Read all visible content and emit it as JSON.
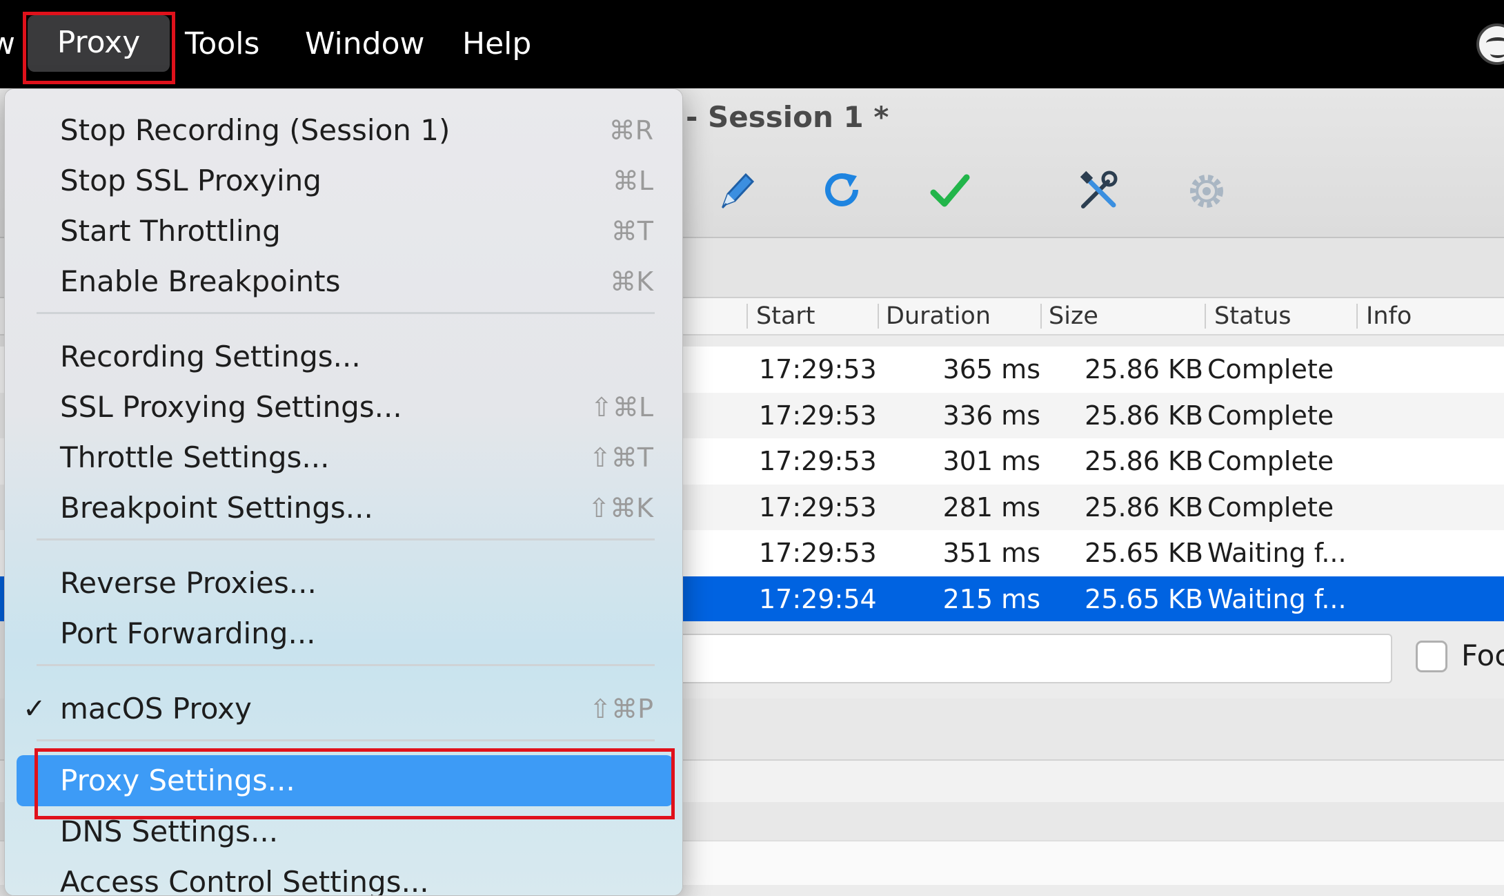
{
  "menubar": {
    "partial_item": "w",
    "items": [
      "Proxy",
      "Tools",
      "Window",
      "Help"
    ],
    "app_icon": "charles-logo-icon"
  },
  "window": {
    "title": "- Session 1 *",
    "toolbar_icons": [
      "pen-icon",
      "refresh-icon",
      "checkmark-icon",
      "tools-icon",
      "gear-icon"
    ]
  },
  "table": {
    "headers": [
      "Start",
      "Duration",
      "Size",
      "Status",
      "Info"
    ],
    "rows": [
      {
        "start": "17:29:53",
        "duration": "365 ms",
        "size": "25.86 KB",
        "status": "Complete"
      },
      {
        "start": "17:29:53",
        "duration": "336 ms",
        "size": "25.86 KB",
        "status": "Complete"
      },
      {
        "start": "17:29:53",
        "duration": "301 ms",
        "size": "25.86 KB",
        "status": "Complete"
      },
      {
        "start": "17:29:53",
        "duration": "281 ms",
        "size": "25.86 KB",
        "status": "Complete"
      },
      {
        "start": "17:29:53",
        "duration": "351 ms",
        "size": "25.65 KB",
        "status": "Waiting f..."
      },
      {
        "start": "17:29:54",
        "duration": "215 ms",
        "size": "25.65 KB",
        "status": "Waiting f..."
      }
    ],
    "selected_row_index": 5
  },
  "filter": {
    "focus_label": "Foc",
    "focus_checked": false
  },
  "menu": {
    "items": [
      {
        "label": "Stop Recording (Session 1)",
        "shortcut": "⌘R"
      },
      {
        "label": "Stop SSL Proxying",
        "shortcut": "⌘L"
      },
      {
        "label": "Start Throttling",
        "shortcut": "⌘T"
      },
      {
        "label": "Enable Breakpoints",
        "shortcut": "⌘K"
      },
      {
        "label": "Recording Settings...",
        "shortcut": ""
      },
      {
        "label": "SSL Proxying Settings...",
        "shortcut": "⇧⌘L"
      },
      {
        "label": "Throttle Settings...",
        "shortcut": "⇧⌘T"
      },
      {
        "label": "Breakpoint Settings...",
        "shortcut": "⇧⌘K"
      },
      {
        "label": "Reverse Proxies...",
        "shortcut": ""
      },
      {
        "label": "Port Forwarding...",
        "shortcut": ""
      },
      {
        "label": "macOS Proxy",
        "shortcut": "⇧⌘P",
        "check": "✓"
      },
      {
        "label": "Proxy Settings...",
        "shortcut": ""
      },
      {
        "label": "DNS Settings...",
        "shortcut": ""
      },
      {
        "label": "Access Control Settings...",
        "shortcut": ""
      }
    ],
    "active_item": "Proxy Settings...",
    "accent_color": "#3d9bf6",
    "highlight_box_color": "#e0111b"
  }
}
